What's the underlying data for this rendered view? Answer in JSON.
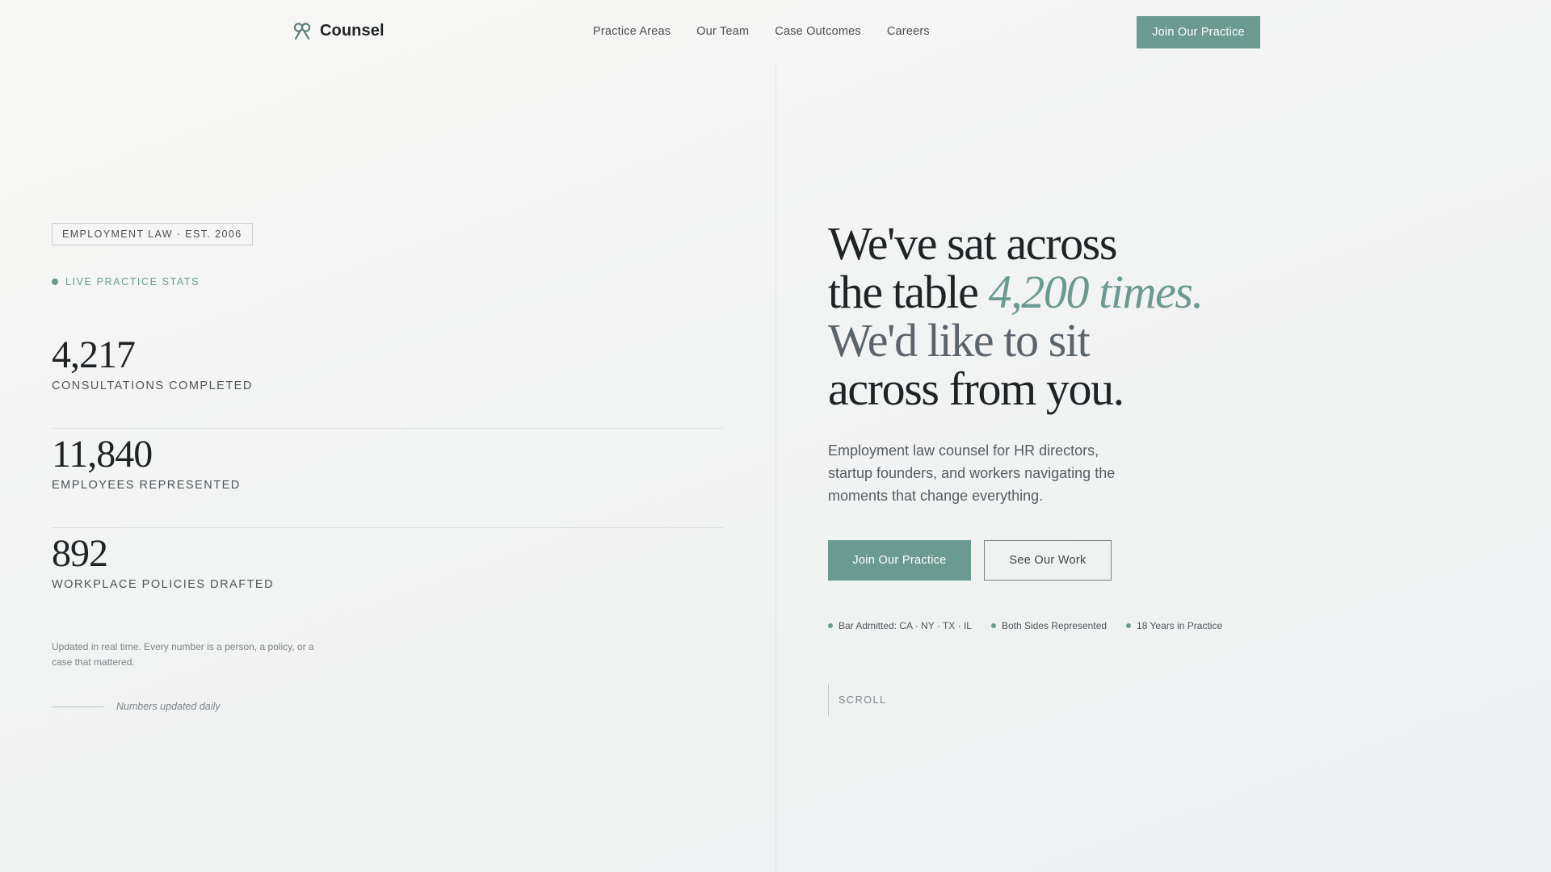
{
  "nav": {
    "brand_icon": "scales-logo-icon",
    "brand_name": "Counsel",
    "links": [
      "Practice Areas",
      "Our Team",
      "Case Outcomes",
      "Careers"
    ],
    "cta_label": "Join Our Practice"
  },
  "left": {
    "tagline": "EMPLOYMENT LAW · EST. 2006",
    "live_label": "LIVE PRACTICE STATS",
    "stats": [
      {
        "value": "4,217",
        "label": "CONSULTATIONS COMPLETED"
      },
      {
        "value": "11,840",
        "label": "EMPLOYEES REPRESENTED"
      },
      {
        "value": "892",
        "label": "WORKPLACE POLICIES DRAFTED"
      }
    ],
    "note": "Updated in real time. Every number is a person, a policy, or a case that mattered.",
    "updated_label": "Numbers updated daily"
  },
  "hero": {
    "line1": "We've sat across",
    "line2_prefix": "the table ",
    "line2_accent": "4,200 times.",
    "line3": "We'd like to sit",
    "line4": "across from you.",
    "subtext": "Employment law counsel for HR directors, startup founders, and workers navigating the moments that change everything.",
    "primary_cta": "Join Our Practice",
    "secondary_cta": "See Our Work",
    "badges": [
      "Bar Admitted: CA · NY · TX · IL",
      "Both Sides Represented",
      "18 Years in Practice"
    ],
    "scroll_label": "SCROLL"
  },
  "colors": {
    "accent": "#6b9a91",
    "text": "#1f2326",
    "muted": "#5c646b"
  }
}
